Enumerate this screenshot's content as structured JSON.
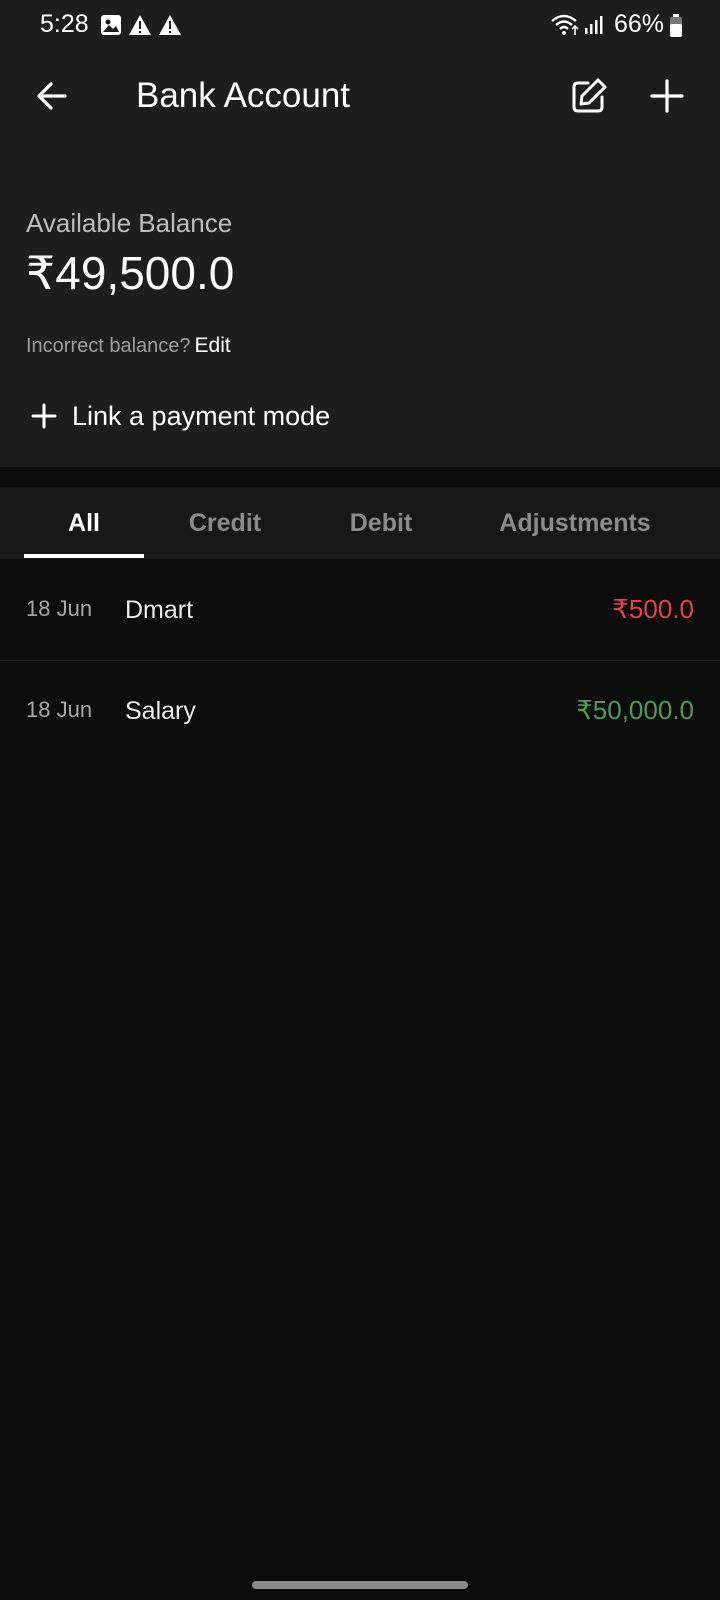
{
  "status_bar": {
    "time": "5:28",
    "battery": "66%",
    "icons": [
      "gallery-icon",
      "warning-icon",
      "warning-icon",
      "wifi-icon",
      "signal-icon",
      "battery-icon"
    ]
  },
  "app_bar": {
    "title": "Bank Account",
    "icons": [
      "back-arrow-icon",
      "edit-icon",
      "add-icon"
    ]
  },
  "balance": {
    "label": "Available Balance",
    "value": "₹49,500.0",
    "incorrect_text": "Incorrect balance?",
    "edit_label": "Edit"
  },
  "link_payment": {
    "label": "Link a payment mode"
  },
  "tabs": [
    {
      "label": "All",
      "active": true
    },
    {
      "label": "Credit",
      "active": false
    },
    {
      "label": "Debit",
      "active": false
    },
    {
      "label": "Adjustments",
      "active": false
    }
  ],
  "transactions": [
    {
      "date": "18 Jun",
      "name": "Dmart",
      "amount": "₹500.0",
      "type": "debit"
    },
    {
      "date": "18 Jun",
      "name": "Salary",
      "amount": "₹50,000.0",
      "type": "credit"
    }
  ],
  "colors": {
    "header_bg": "#1d1d1e",
    "page_bg": "#0c0c0c",
    "debit": "#e04444",
    "credit": "#4f9a55"
  }
}
